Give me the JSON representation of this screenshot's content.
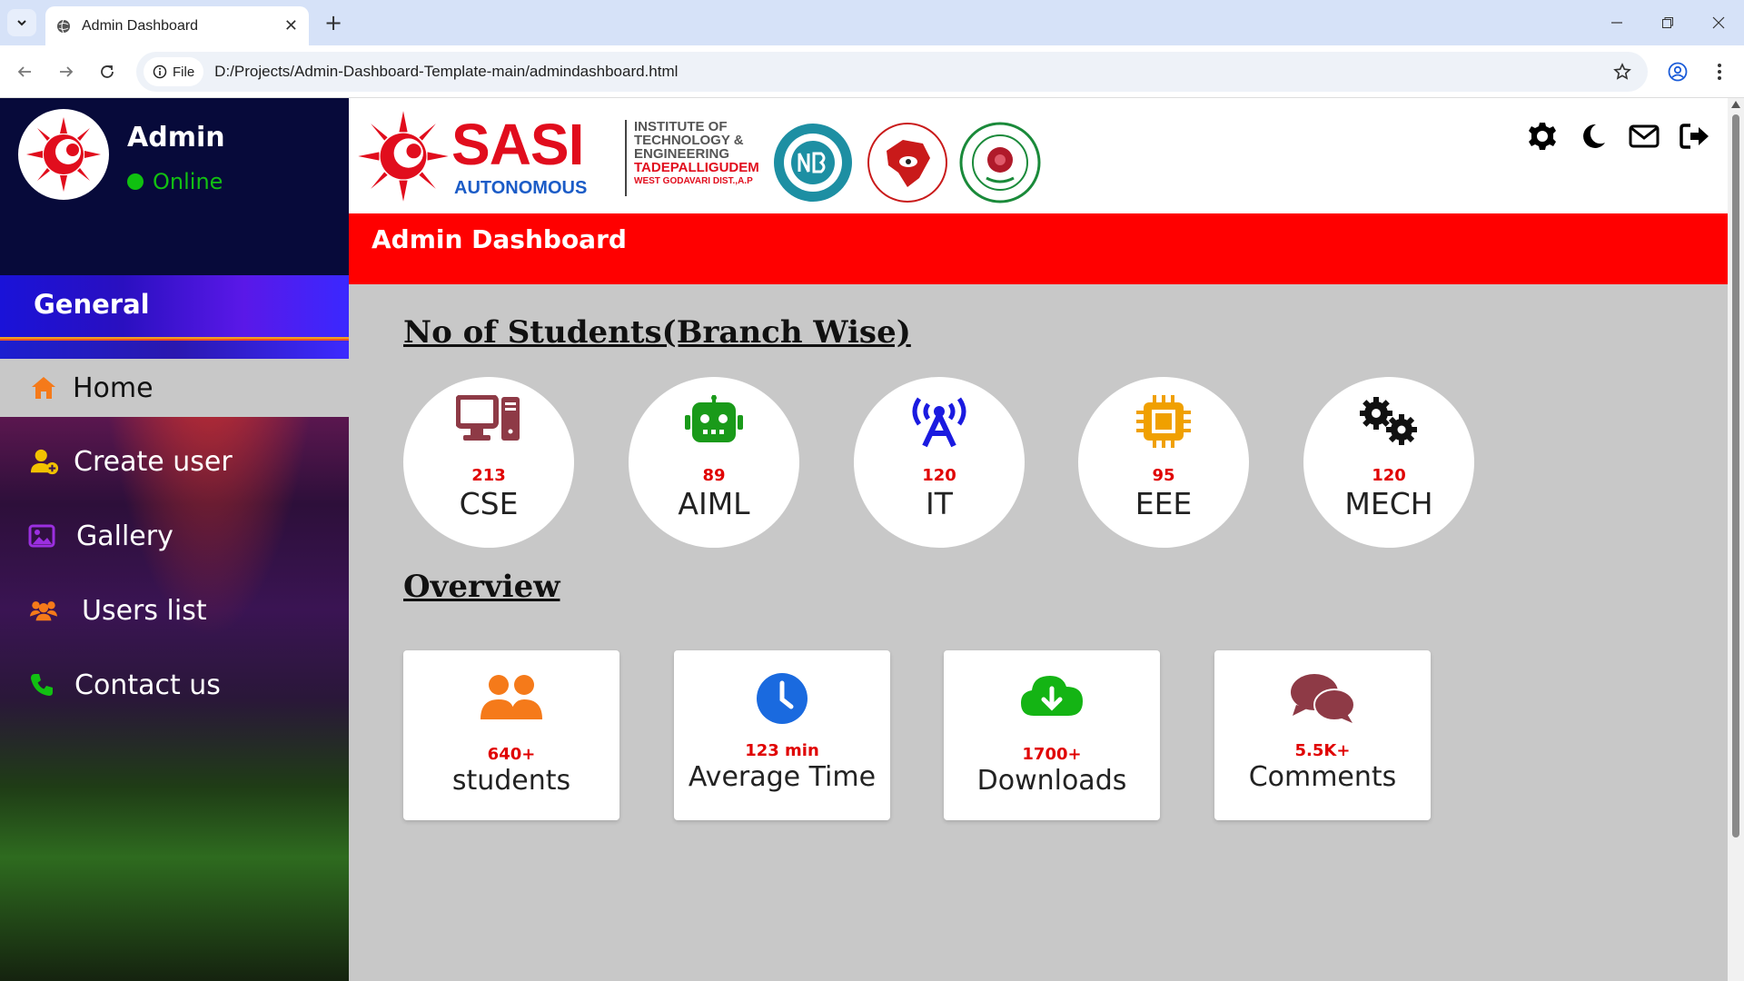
{
  "browser": {
    "tab_title": "Admin Dashboard",
    "file_chip": "File",
    "url": "D:/Projects/Admin-Dashboard-Template-main/admindashboard.html"
  },
  "sidebar": {
    "admin_name": "Admin",
    "status": "Online",
    "section_label": "General",
    "items": [
      {
        "label": "Home",
        "icon": "home-icon",
        "active": true
      },
      {
        "label": "Create user",
        "icon": "user-plus-icon"
      },
      {
        "label": "Gallery",
        "icon": "image-icon"
      },
      {
        "label": "Users list",
        "icon": "users-icon"
      },
      {
        "label": "Contact us",
        "icon": "phone-icon"
      }
    ]
  },
  "header": {
    "logo_main": "SASI",
    "logo_sub": "AUTONOMOUS",
    "institute_lines": [
      "INSTITUTE OF",
      "TECHNOLOGY &",
      "ENGINEERING",
      "TADEPALLIGUDEM",
      "WEST GODAVARI DIST.,A.P"
    ],
    "icons": [
      "gear-icon",
      "moon-icon",
      "mail-icon",
      "logout-icon"
    ]
  },
  "title_bar": "Admin Dashboard",
  "branches_title": "No of Students(Branch Wise)",
  "branches": [
    {
      "name": "CSE",
      "count": "213",
      "icon": "desktop-icon",
      "color": "#8e3a46"
    },
    {
      "name": "AIML",
      "count": "89",
      "icon": "robot-icon",
      "color": "#1a9a1a"
    },
    {
      "name": "IT",
      "count": "120",
      "icon": "tower-broadcast-icon",
      "color": "#1a1ae0"
    },
    {
      "name": "EEE",
      "count": "95",
      "icon": "microchip-icon",
      "color": "#f0a000"
    },
    {
      "name": "MECH",
      "count": "120",
      "icon": "gears-icon",
      "color": "#111111"
    }
  ],
  "overview_title": "Overview",
  "overview": [
    {
      "value": "640+",
      "label": "students",
      "icon": "user-group-icon",
      "color": "#f57a1a"
    },
    {
      "value": "123 min",
      "label": "Average Time",
      "icon": "clock-icon",
      "color": "#1a6adf"
    },
    {
      "value": "1700+",
      "label": "Downloads",
      "icon": "cloud-download-icon",
      "color": "#14b414"
    },
    {
      "value": "5.5K+",
      "label": "Comments",
      "icon": "comments-icon",
      "color": "#8e3a46"
    }
  ]
}
